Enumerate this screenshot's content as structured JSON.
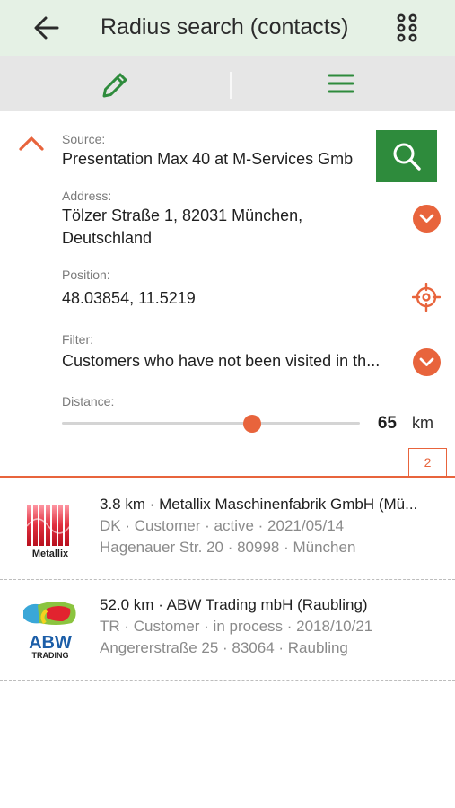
{
  "colors": {
    "accent_green": "#2e8b3c",
    "accent_orange": "#e8643c",
    "appbar_bg": "#e5f1e5",
    "toolbar_bg": "#e6e6e6"
  },
  "header": {
    "title": "Radius search (contacts)",
    "back_icon": "arrow-left-icon",
    "apps_icon": "dots-grid-icon"
  },
  "toolbar": {
    "edit_icon": "pencil-icon",
    "menu_icon": "hamburger-menu-icon"
  },
  "details": {
    "collapse_icon": "chevron-up-icon",
    "source_label": "Source:",
    "source_value": "Presentation Max 40 at M-Services Gmb",
    "search_icon": "search-icon",
    "address_label": "Address:",
    "address_value": "Tölzer Straße 1, 82031 München, Deutschland",
    "position_label": "Position:",
    "position_value": "48.03854, 11.5219",
    "filter_label": "Filter:",
    "filter_value": "Customers who have not been visited in th...",
    "distance_label": "Distance:",
    "distance_value": "65",
    "distance_unit": "km",
    "distance_slider_fraction": 0.64,
    "result_count": "2"
  },
  "results": [
    {
      "logo_text": "Metallix",
      "line1": "3.8 km · Metallix Maschinenfabrik GmbH (Mü...",
      "line2": "DK · Customer · active · 2021/05/14",
      "line3": "Hagenauer Str. 20 · 80998 · München"
    },
    {
      "logo_text": "ABW TRADING",
      "line1": "52.0 km · ABW Trading mbH (Raubling)",
      "line2": "TR · Customer · in process · 2018/10/21",
      "line3": "Angererstraße 25 · 83064 · Raubling"
    }
  ]
}
